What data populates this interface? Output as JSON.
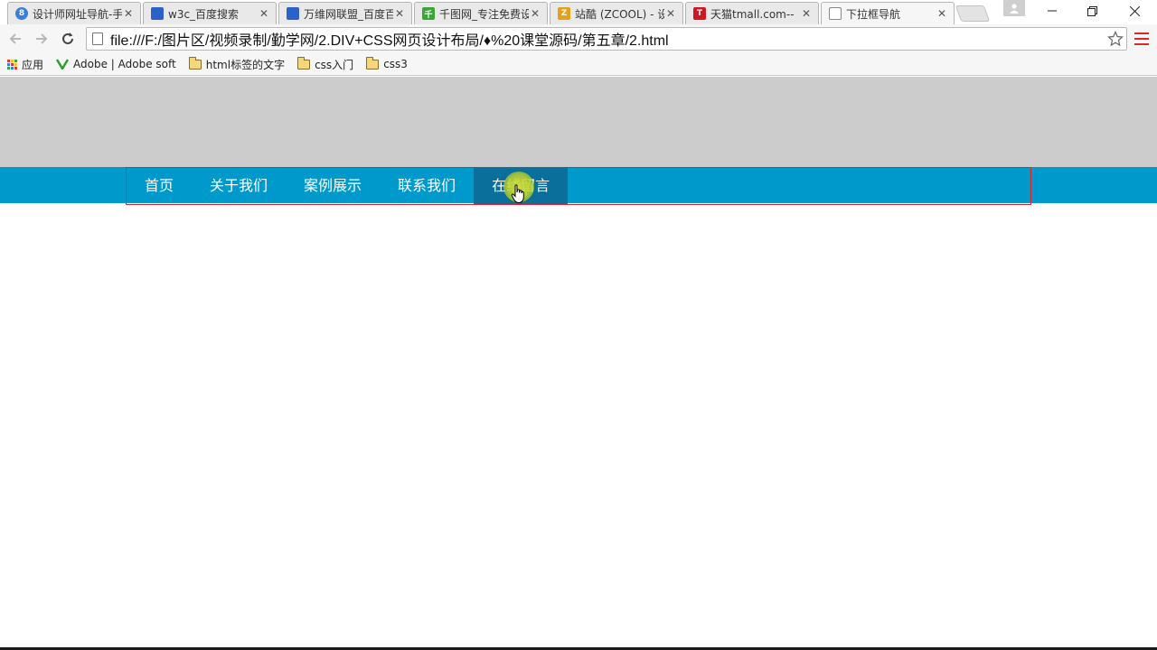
{
  "browser": {
    "tabs": [
      {
        "title": "设计师网址导航-手",
        "favicon": "circle-8-icon",
        "color": "#3b7dd8",
        "active": false
      },
      {
        "title": "w3c_百度搜索",
        "favicon": "baidu-paw-icon",
        "color": "#2f5fc8",
        "active": false
      },
      {
        "title": "万维网联盟_百度百",
        "favicon": "baidu-paw-icon",
        "color": "#2f5fc8",
        "active": false
      },
      {
        "title": "千图网_专注免费设",
        "favicon": "qiantu-icon",
        "color": "#3aa63a",
        "active": false
      },
      {
        "title": "站酷 (ZCOOL) - 设",
        "favicon": "zcool-icon",
        "color": "#e4a21b",
        "active": false
      },
      {
        "title": "天猫tmall.com--",
        "favicon": "tmall-icon",
        "color": "#d0161f",
        "active": false
      },
      {
        "title": "下拉框导航",
        "favicon": "page-icon",
        "color": "#888888",
        "active": true
      }
    ],
    "address_bar": {
      "url": "file:///F:/图片区/视频录制/勤学网/2.DIV+CSS网页设计布局/♦%20课堂源码/第五章/2.html"
    },
    "bookmarks": [
      {
        "label": "应用",
        "icon": "apps-grid-icon"
      },
      {
        "label": "Adobe | Adobe soft",
        "icon": "vector-v-icon"
      },
      {
        "label": "html标签的文字",
        "icon": "folder-icon"
      },
      {
        "label": "css入门",
        "icon": "folder-icon"
      },
      {
        "label": "css3",
        "icon": "folder-icon"
      }
    ]
  },
  "page": {
    "nav": {
      "items": [
        "首页",
        "关于我们",
        "案例展示",
        "联系我们",
        "在线留言"
      ],
      "active_index": 4
    }
  },
  "colors": {
    "hero_bg": "#cccccc",
    "nav_bg": "#0099cc",
    "nav_active_bg": "#0a6f9a",
    "nav_outline": "#e0202b"
  }
}
